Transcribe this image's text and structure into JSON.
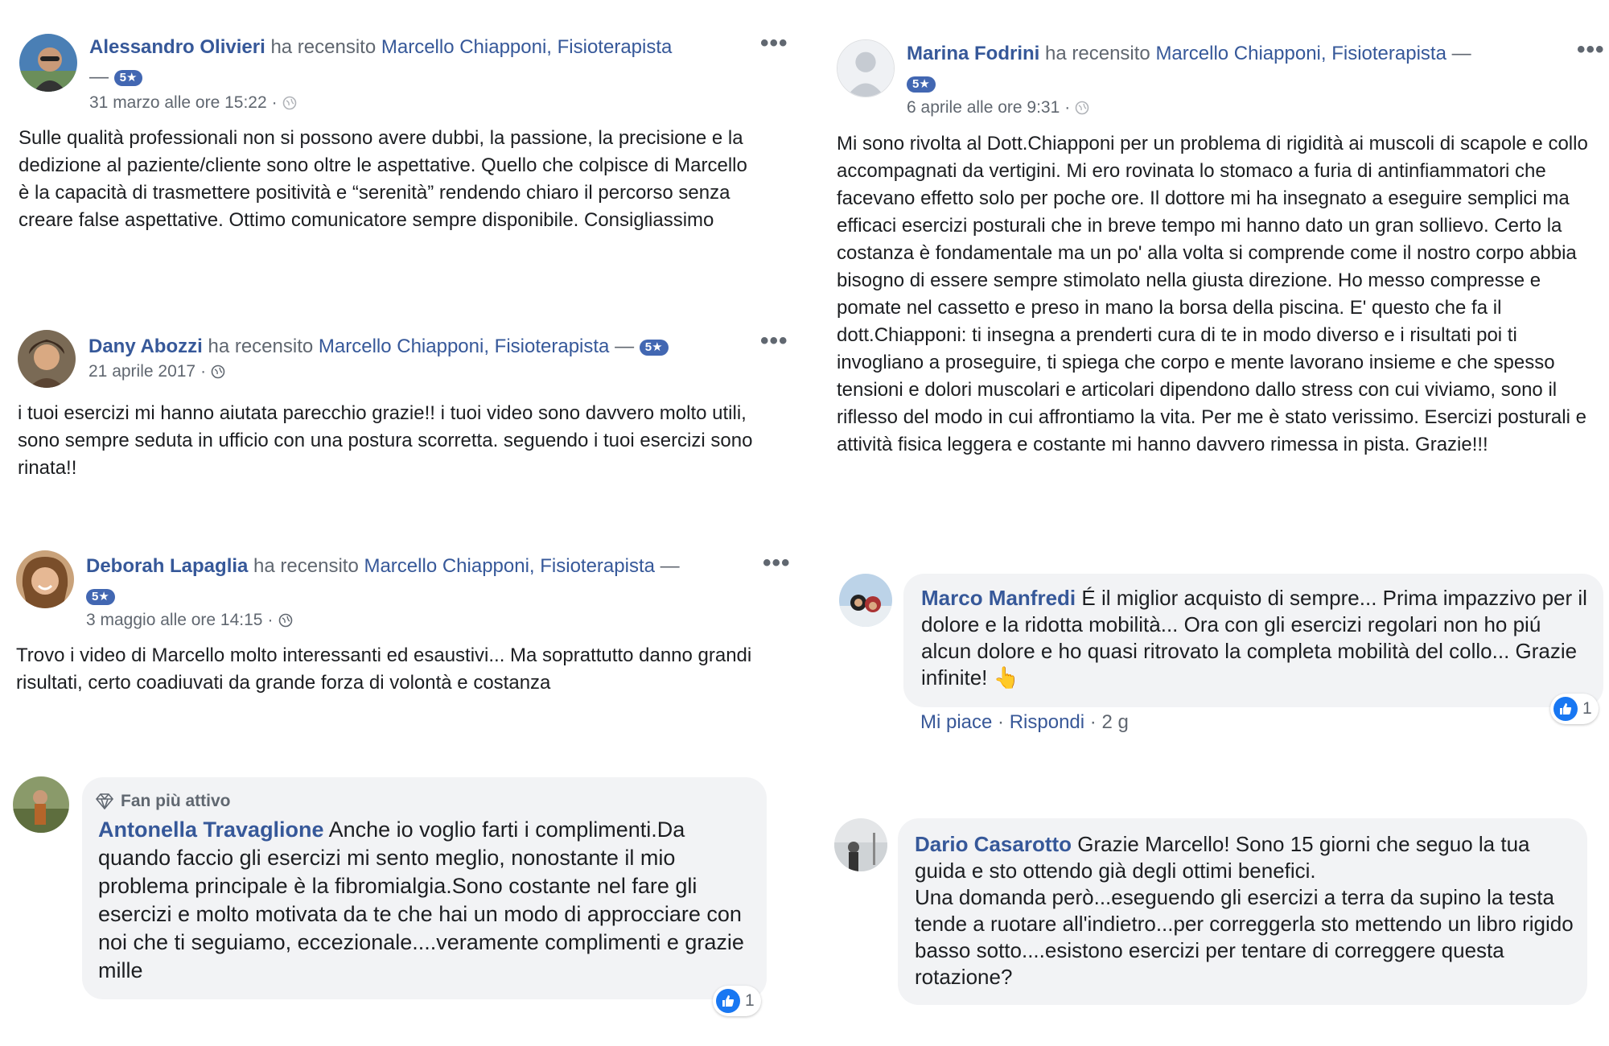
{
  "common": {
    "reviewed_text": "ha recensito",
    "page_name": "Marcello Chiapponi, Fisioterapista",
    "dash": "—",
    "stars": "5★",
    "more": "•••",
    "dot": "·"
  },
  "reviews": [
    {
      "name": "Alessandro Olivieri",
      "date": "31 marzo alle ore 15:22",
      "text": "Sulle qualità professionali non si possono avere dubbi, la passione, la precisione e la dedizione al paziente/cliente sono oltre le aspettative. Quello che colpisce di Marcello è la capacità di trasmettere positività e “serenità” rendendo chiaro il percorso senza creare false aspettative. Ottimo comunicatore sempre disponibile. Consigliassimo"
    },
    {
      "name": "Dany Abozzi",
      "date": "21 aprile 2017",
      "text": "i tuoi esercizi mi hanno aiutata parecchio grazie!! i tuoi video sono davvero molto utili, sono sempre seduta in ufficio con una postura scorretta. seguendo i tuoi esercizi sono rinata!!"
    },
    {
      "name": "Deborah Lapaglia",
      "date": "3 maggio alle ore 14:15",
      "text": "Trovo i video di Marcello molto interessanti ed esaustivi... Ma soprattutto danno grandi risultati, certo coadiuvati da grande forza di volontà e costanza"
    },
    {
      "name": "Marina Fodrini",
      "date": "6 aprile alle ore 9:31",
      "text": "Mi sono rivolta al Dott.Chiapponi per un problema di rigidità ai muscoli di scapole e collo accompagnati da vertigini. Mi ero rovinata lo stomaco a furia di antinfiammatori che facevano effetto solo per poche ore. Il dottore mi ha insegnato a eseguire semplici ma efficaci esercizi posturali che in breve tempo mi hanno dato un gran sollievo. Certo la costanza è fondamentale ma un po' alla volta si comprende come il nostro corpo abbia bisogno di essere sempre stimolato nella giusta direzione. Ho messo compresse e pomate nel cassetto e preso in mano la borsa della piscina. E' questo che fa il dott.Chiapponi: ti insegna a prenderti cura di te in modo diverso e i risultati poi ti invogliano a proseguire, ti spiega che corpo e mente lavorano insieme e che spesso tensioni e dolori muscolari e articolari dipendono dallo stress con cui viviamo, sono il riflesso del modo in cui affrontiamo la vita. Per me è stato verissimo. Esercizi posturali e attività fisica leggera e costante mi hanno davvero rimessa in pista. Grazie!!!"
    }
  ],
  "comments": [
    {
      "badge": "Fan più attivo",
      "name": "Antonella Travaglione",
      "text": "Anche io voglio farti i complimenti.Da quando faccio gli esercizi mi sento meglio, nonostante il mio problema principale è la fibromialgia.Sono costante nel fare gli esercizi e molto motivata da te che hai un modo di approcciare con noi che ti seguiamo, eccezionale....veramente complimenti e grazie mille",
      "likes": "1"
    },
    {
      "name": "Marco Manfredi",
      "text": "É il miglior acquisto di sempre... Prima impazzivo per il dolore e la ridotta mobilità... Ora con gli esercizi regolari non ho piú alcun dolore e ho quasi ritrovato la completa mobilità del collo... Grazie infinite!",
      "emoji": "👆",
      "likes": "1",
      "like_action": "Mi piace",
      "reply_action": "Rispondi",
      "time": "2 g"
    },
    {
      "name": "Dario Casarotto",
      "text": "Grazie Marcello! Sono 15 giorni che seguo la tua guida e sto ottendo già degli ottimi benefici.",
      "text2": "Una domanda però...eseguendo gli esercizi a terra da supino la testa tende a ruotare all'indietro...per correggerla sto mettendo un libro rigido basso sotto....esistono esercizi per tentare di correggere questa rotazione?"
    }
  ],
  "colors": {
    "link": "#365899",
    "bubble": "#f2f3f5",
    "like": "#1877f2",
    "stars": "#4267b2"
  },
  "icons": {
    "globe": "globe-icon",
    "more": "more-options-icon",
    "like": "like-icon",
    "fan": "diamond-icon"
  }
}
